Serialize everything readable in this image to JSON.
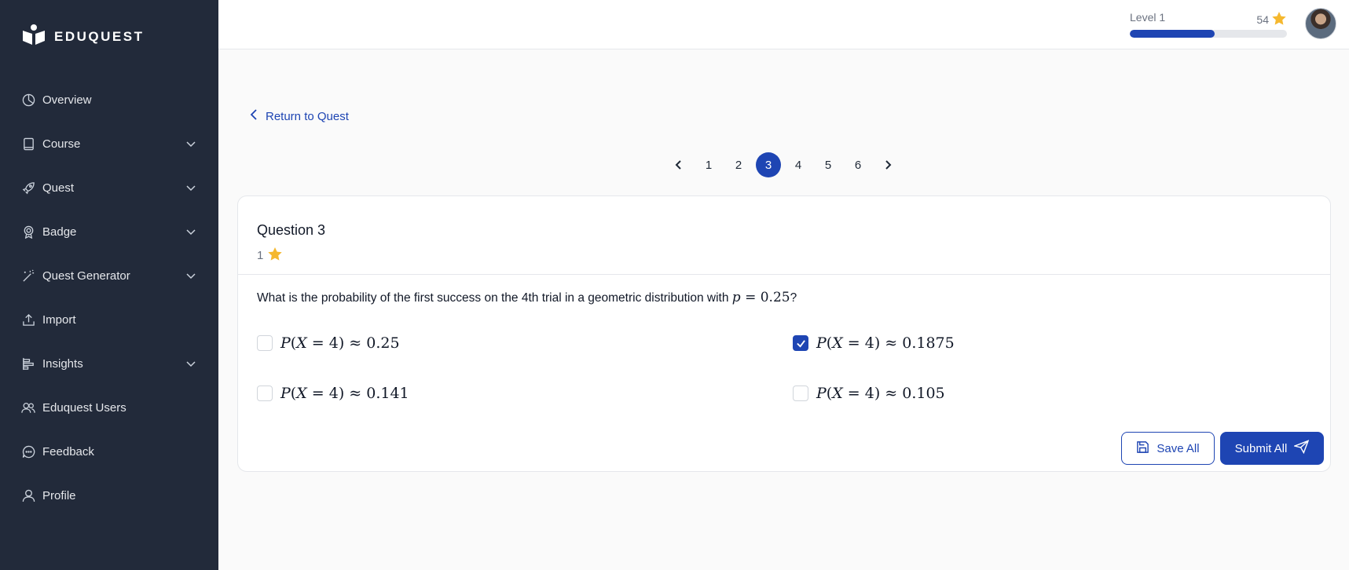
{
  "brand": {
    "name": "EDUQUEST"
  },
  "sidebar": {
    "items": [
      {
        "label": "Overview",
        "icon": "chart-pie-icon",
        "expandable": false
      },
      {
        "label": "Course",
        "icon": "book-icon",
        "expandable": true
      },
      {
        "label": "Quest",
        "icon": "rocket-icon",
        "expandable": true
      },
      {
        "label": "Badge",
        "icon": "badge-icon",
        "expandable": true
      },
      {
        "label": "Quest Generator",
        "icon": "magic-wand-icon",
        "expandable": true
      },
      {
        "label": "Import",
        "icon": "upload-icon",
        "expandable": false
      },
      {
        "label": "Insights",
        "icon": "bar-chart-icon",
        "expandable": true
      },
      {
        "label": "Eduquest Users",
        "icon": "users-icon",
        "expandable": false
      },
      {
        "label": "Feedback",
        "icon": "chat-bubble-icon",
        "expandable": false
      },
      {
        "label": "Profile",
        "icon": "user-icon",
        "expandable": false
      }
    ]
  },
  "header": {
    "level_label": "Level 1",
    "points": "54",
    "level_progress": 0.54
  },
  "main": {
    "return_label": "Return to Quest",
    "pagination": {
      "pages": [
        "1",
        "2",
        "3",
        "4",
        "5",
        "6"
      ],
      "current": "3"
    },
    "question": {
      "title": "Question 3",
      "points": "1",
      "text_before": "What is the probability of the first success on the 4th trial in a geometric distribution with ",
      "text_math": "p = 0.25",
      "text_after": "?",
      "options": [
        {
          "value": "0.25",
          "checked": false
        },
        {
          "value": "0.1875",
          "checked": true
        },
        {
          "value": "0.141",
          "checked": false
        },
        {
          "value": "0.105",
          "checked": false
        }
      ]
    },
    "actions": {
      "save_label": "Save All",
      "submit_label": "Submit All"
    }
  },
  "colors": {
    "sidebar_bg": "#222a3a",
    "accent": "#1e45b3",
    "star": "#f5b82e"
  }
}
